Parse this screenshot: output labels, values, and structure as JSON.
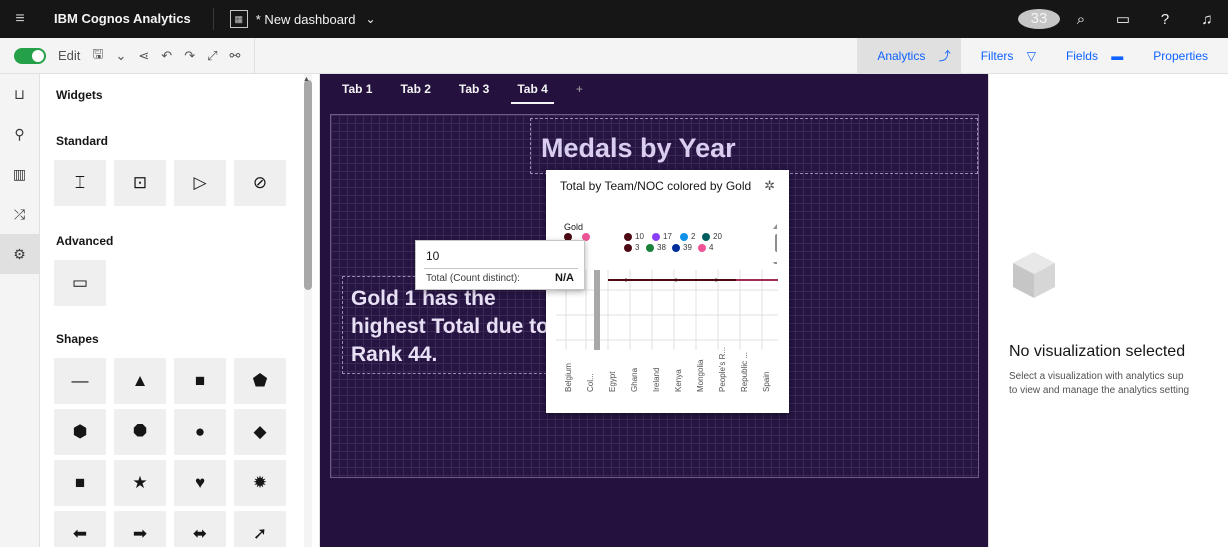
{
  "topbar": {
    "brand": "IBM Cognos Analytics",
    "dashboard_name": "* New dashboard",
    "notif_count": "33"
  },
  "toolbar": {
    "edit_label": "Edit",
    "analytics": "Analytics",
    "filters": "Filters",
    "fields": "Fields",
    "properties": "Properties"
  },
  "widgets": {
    "title": "Widgets",
    "standard": "Standard",
    "advanced": "Advanced",
    "shapes": "Shapes",
    "shape_icons": [
      "line",
      "triangle",
      "square",
      "pentagon",
      "hexagon",
      "octagon",
      "circle",
      "diamond",
      "rounded-square",
      "star",
      "heart",
      "burst",
      "arrow-left",
      "arrow-right",
      "arrow-both",
      "arrow-curved"
    ]
  },
  "tabs": [
    "Tab 1",
    "Tab 2",
    "Tab 3",
    "Tab 4",
    "+"
  ],
  "canvas": {
    "title": "Medals by Year",
    "insight": "Gold 1 has the highest Total due to Rank 44."
  },
  "viz": {
    "title": "Total by Team/NOC colored by Gold",
    "legend_title": "Gold",
    "legend": [
      {
        "label": "10",
        "color": "#4d0a14"
      },
      {
        "label": "17",
        "color": "#8a3ffc"
      },
      {
        "label": "2",
        "color": "#1192e8"
      },
      {
        "label": "20",
        "color": "#005d5d"
      },
      {
        "label": "3",
        "color": "#4d0a14"
      },
      {
        "label": "38",
        "color": "#198038"
      },
      {
        "label": "39",
        "color": "#002d9c"
      },
      {
        "label": "4",
        "color": "#ee5396"
      }
    ],
    "x_labels": [
      "Belgium",
      "Col...",
      "Egypt",
      "Ghana",
      "Ireland",
      "Kenya",
      "Mongolia",
      "People's R...",
      "Republic ...",
      "Spain"
    ]
  },
  "tooltip": {
    "value": "10",
    "label": "Total (Count distinct):",
    "result": "N/A"
  },
  "right_panel": {
    "title": "No visualization selected",
    "line1": "Select a visualization with analytics sup",
    "line2": "to view and manage the analytics setting"
  }
}
